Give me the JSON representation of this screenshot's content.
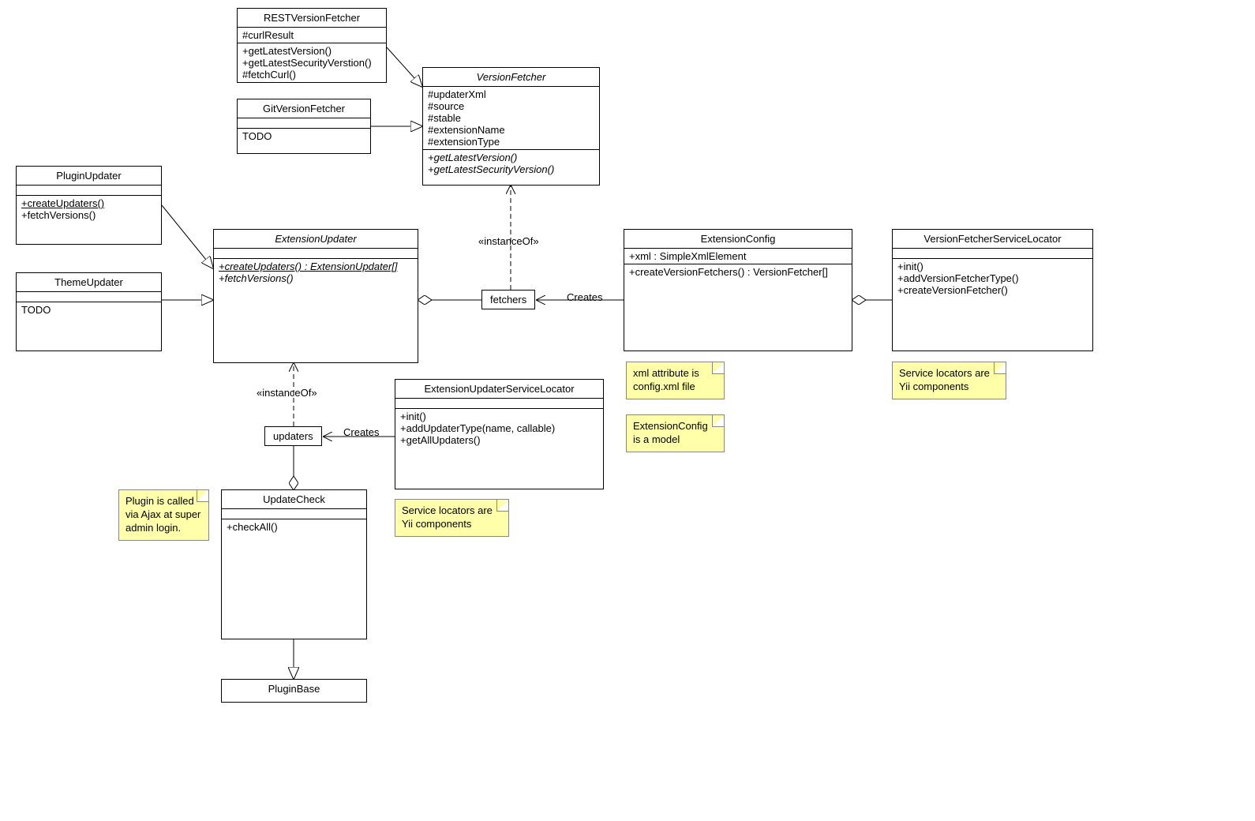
{
  "classes": {
    "RESTVersionFetcher": {
      "title": "RESTVersionFetcher",
      "attrs": [
        "#curlResult"
      ],
      "ops": [
        "+getLatestVersion()",
        "+getLatestSecurityVerstion()",
        "#fetchCurl()"
      ]
    },
    "GitVersionFetcher": {
      "title": "GitVersionFetcher",
      "attrs": [],
      "ops": [
        "TODO"
      ]
    },
    "VersionFetcher": {
      "title": "VersionFetcher",
      "italic": true,
      "attrs": [
        "#updaterXml",
        "#source",
        "#stable",
        "#extensionName",
        "#extensionType"
      ],
      "ops_italic": [
        "+getLatestVersion()",
        "+getLatestSecurityVersion()"
      ]
    },
    "PluginUpdater": {
      "title": "PluginUpdater",
      "attrs": [],
      "ops_underline": [
        "+createUpdaters()"
      ],
      "ops": [
        "+fetchVersions()"
      ]
    },
    "ThemeUpdater": {
      "title": "ThemeUpdater",
      "attrs": [],
      "ops": [
        "TODO"
      ]
    },
    "ExtensionUpdater": {
      "title": "ExtensionUpdater",
      "italic": true,
      "attrs": [],
      "ops_underline_italic": [
        "+createUpdaters() : ExtensionUpdater[]"
      ],
      "ops_italic": [
        "+fetchVersions()"
      ]
    },
    "ExtensionConfig": {
      "title": "ExtensionConfig",
      "attrs": [
        "+xml : SimpleXmlElement"
      ],
      "ops": [
        "+createVersionFetchers() : VersionFetcher[]"
      ]
    },
    "VersionFetcherServiceLocator": {
      "title": "VersionFetcherServiceLocator",
      "attrs": [],
      "ops": [
        "+init()",
        "+addVersionFetcherType()",
        "+createVersionFetcher()"
      ]
    },
    "ExtensionUpdaterServiceLocator": {
      "title": "ExtensionUpdaterServiceLocator",
      "attrs": [],
      "ops": [
        "+init()",
        "+addUpdaterType(name, callable)",
        "+getAllUpdaters()"
      ]
    },
    "UpdateCheck": {
      "title": "UpdateCheck",
      "attrs": [],
      "ops": [
        "+checkAll()"
      ]
    },
    "PluginBase": {
      "title": "PluginBase"
    }
  },
  "small": {
    "fetchers": "fetchers",
    "updaters": "updaters"
  },
  "labels": {
    "instanceOf1": "«instanceOf»",
    "instanceOf2": "«instanceOf»",
    "creates1": "Creates",
    "creates2": "Creates"
  },
  "notes": {
    "xmlattr": "xml attribute is\nconfig.xml file",
    "extconfig": "ExtensionConfig\nis a model",
    "svc1": "Service locators\nare Yii components",
    "svc2": "Service locators\nare Yii components",
    "plugin": "Plugin is\ncalled via Ajax\nat super admin\nlogin."
  }
}
